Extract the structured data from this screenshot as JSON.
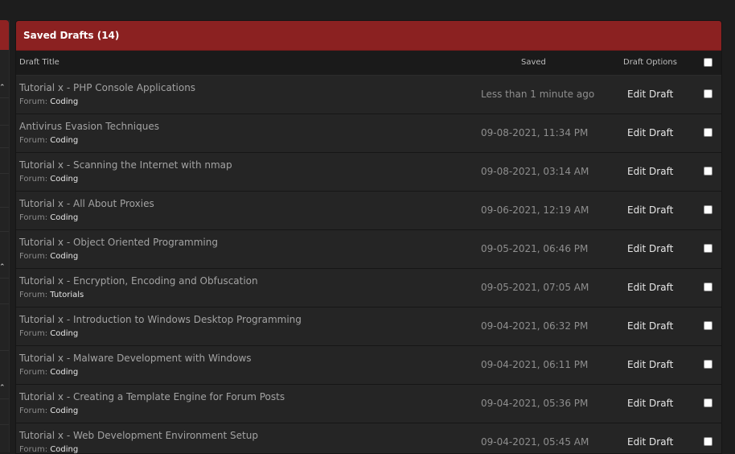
{
  "panel": {
    "title": "Saved Drafts (14)",
    "columns": {
      "draft_title": "Draft Title",
      "saved": "Saved",
      "draft_options": "Draft Options"
    },
    "forum_prefix": "Forum:",
    "edit_label": "Edit Draft",
    "header_color": "#8b2121",
    "rows": [
      {
        "title": "Tutorial x - PHP Console Applications",
        "forum": "Coding",
        "saved": "Less than 1 minute ago"
      },
      {
        "title": "Antivirus Evasion Techniques",
        "forum": "Coding",
        "saved": "09-08-2021, 11:34 PM"
      },
      {
        "title": "Tutorial x - Scanning the Internet with nmap",
        "forum": "Coding",
        "saved": "09-08-2021, 03:14 AM"
      },
      {
        "title": "Tutorial x - All About Proxies",
        "forum": "Coding",
        "saved": "09-06-2021, 12:19 AM"
      },
      {
        "title": "Tutorial x - Object Oriented Programming",
        "forum": "Coding",
        "saved": "09-05-2021, 06:46 PM"
      },
      {
        "title": "Tutorial x - Encryption, Encoding and Obfuscation",
        "forum": "Tutorials",
        "saved": "09-05-2021, 07:05 AM"
      },
      {
        "title": "Tutorial x - Introduction to Windows Desktop Programming",
        "forum": "Coding",
        "saved": "09-04-2021, 06:32 PM"
      },
      {
        "title": "Tutorial x - Malware Development with Windows",
        "forum": "Coding",
        "saved": "09-04-2021, 06:11 PM"
      },
      {
        "title": "Tutorial x - Creating a Template Engine for Forum Posts",
        "forum": "Coding",
        "saved": "09-04-2021, 05:36 PM"
      },
      {
        "title": "Tutorial x - Web Development Environment Setup",
        "forum": "Coding",
        "saved": "09-04-2021, 05:45 AM"
      }
    ]
  },
  "left_sidebar": {
    "toggle_icon": "chevron-up-icon"
  }
}
